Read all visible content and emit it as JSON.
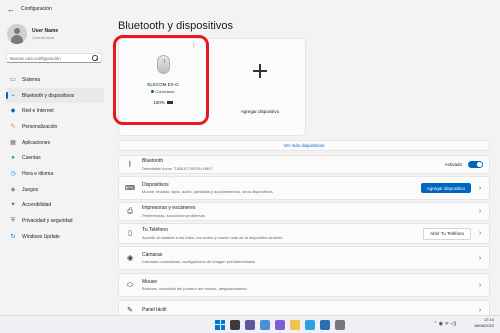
{
  "app": {
    "title": "Configuración",
    "back_glyph": "←"
  },
  "profile": {
    "name": "User Name",
    "subtitle": "Cuenta local"
  },
  "search": {
    "placeholder": "Buscar una configuración"
  },
  "sidebar": {
    "items": [
      {
        "label": "Sistema",
        "icon": "system-icon",
        "glyph": "▭",
        "color": "#0078d4",
        "active": false
      },
      {
        "label": "Bluetooth y dispositivos",
        "icon": "bluetooth-devices-icon",
        "glyph": "⌁",
        "color": "#0078d4",
        "active": true
      },
      {
        "label": "Red e Internet",
        "icon": "network-icon",
        "glyph": "◆",
        "color": "#0a5fb4",
        "active": false
      },
      {
        "label": "Personalización",
        "icon": "personalization-icon",
        "glyph": "✎",
        "color": "#e37b1b",
        "active": false
      },
      {
        "label": "Aplicaciones",
        "icon": "apps-icon",
        "glyph": "▦",
        "color": "#6b6b6b",
        "active": false
      },
      {
        "label": "Cuentas",
        "icon": "accounts-icon",
        "glyph": "●",
        "color": "#1fa35c",
        "active": false
      },
      {
        "label": "Hora e idioma",
        "icon": "time-language-icon",
        "glyph": "◷",
        "color": "#2b88d8",
        "active": false
      },
      {
        "label": "Juegos",
        "icon": "gaming-icon",
        "glyph": "◈",
        "color": "#6b6b6b",
        "active": false
      },
      {
        "label": "Accesibilidad",
        "icon": "accessibility-icon",
        "glyph": "✦",
        "color": "#1a73c7",
        "active": false
      },
      {
        "label": "Privacidad y seguridad",
        "icon": "privacy-shield-icon",
        "glyph": "⛨",
        "color": "#6b6b6b",
        "active": false
      },
      {
        "label": "Windows Update",
        "icon": "windows-update-icon",
        "glyph": "↻",
        "color": "#0078d4",
        "active": false
      }
    ]
  },
  "main": {
    "title": "Bluetooth y dispositivos",
    "device": {
      "name": "ELECOM EX-G",
      "status": "Conectado",
      "battery": "100%"
    },
    "add_device_label": "Agregar dispositivo",
    "see_more": "Ver más dispositivos",
    "rows": [
      {
        "id": "bluetooth",
        "icon": "bluetooth-icon",
        "glyph": "ᛒ",
        "title": "Bluetooth",
        "subtitle": "Detectable como \"TABLET-RESLLH8O\"",
        "state_label": "Activado",
        "toggle_on": true
      },
      {
        "id": "devices",
        "icon": "devices-icon",
        "glyph": "⌨",
        "title": "Dispositivos",
        "subtitle": "Mouse, teclado, lápiz, audio, pantallas y acoplamientos, otros dispositivos",
        "button": "Agregar dispositivo"
      },
      {
        "id": "printers",
        "icon": "printer-icon",
        "glyph": "⎙",
        "title": "Impresoras y escáneres",
        "subtitle": "Preferencias, solucionar problemas"
      },
      {
        "id": "phone",
        "icon": "phone-icon",
        "glyph": "▯",
        "title": "Tu Teléfono",
        "subtitle": "Accede al instante a las fotos, los textos y mucho más de tu dispositivo Android",
        "button": "Abrir Tu Teléfono"
      },
      {
        "id": "cameras",
        "icon": "camera-icon",
        "glyph": "◉",
        "title": "Cámaras",
        "subtitle": "Cámaras conectadas, configuración de imagen predeterminada"
      },
      {
        "id": "mouse",
        "icon": "mouse-icon",
        "glyph": "⬭",
        "title": "Mouse",
        "subtitle": "Botones, velocidad del puntero del mouse, desplazamiento"
      },
      {
        "id": "pen",
        "icon": "pen-icon",
        "glyph": "✎",
        "title": "Panel táctil",
        "subtitle": ""
      }
    ]
  },
  "taskbar": {
    "time": "17:10",
    "date": "16/06/2022",
    "tray_glyphs": "⌃ ◉ ᯤ ◁)"
  },
  "colors": {
    "accent": "#0067c0",
    "highlight": "#e8191e"
  }
}
